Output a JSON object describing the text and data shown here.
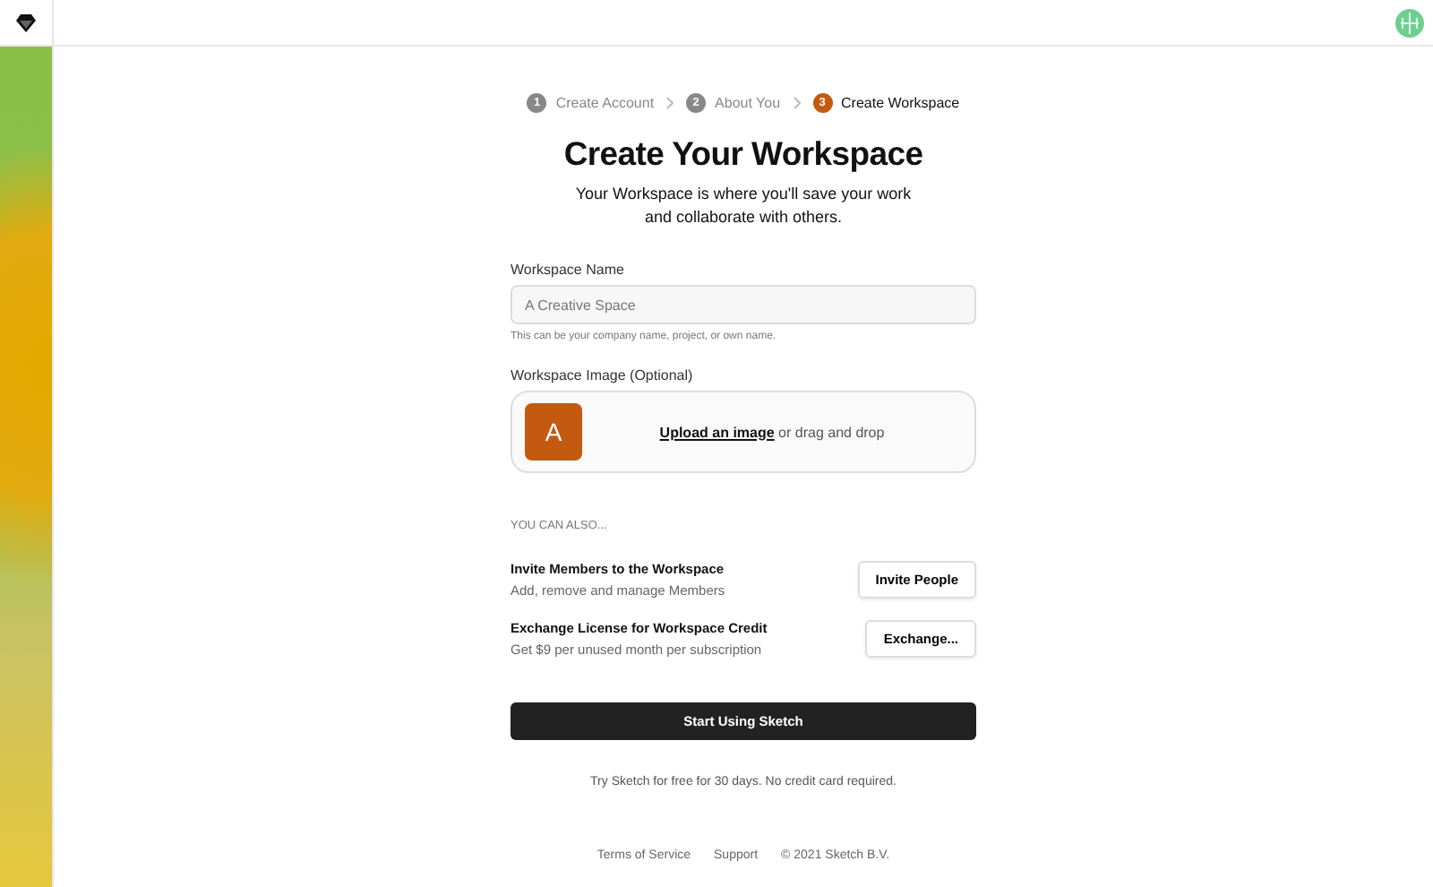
{
  "steps": [
    {
      "number": "1",
      "label": "Create Account",
      "selected": false
    },
    {
      "number": "2",
      "label": "About You",
      "selected": false
    },
    {
      "number": "3",
      "label": "Create Workspace",
      "selected": true
    }
  ],
  "title": "Create Your Workspace",
  "subtitle": [
    "Your Workspace is where you'll save your work",
    "and collaborate with others."
  ],
  "name_field": {
    "label": "Workspace Name",
    "placeholder": "A Creative Space",
    "hint": "This can be your company name, project, or own name."
  },
  "image_field": {
    "label": "Workspace Image (Optional)",
    "initial": "A",
    "link": "Upload an image",
    "text": "or drag and drop"
  },
  "also_heading": "YOU CAN ALSO...",
  "options": [
    {
      "title": "Invite Members to the Workspace",
      "description": "Add, remove and manage Members",
      "button": "Invite People"
    },
    {
      "title": "Exchange License for Workspace Credit",
      "description": "Get $9 per unused month per subscription",
      "button": "Exchange..."
    }
  ],
  "primary_button": "Start Using Sketch",
  "trial_note": "Try Sketch for free for 30 days. No credit card required.",
  "footer": [
    "Terms of Service",
    "Support",
    "© 2021 Sketch B.V."
  ]
}
